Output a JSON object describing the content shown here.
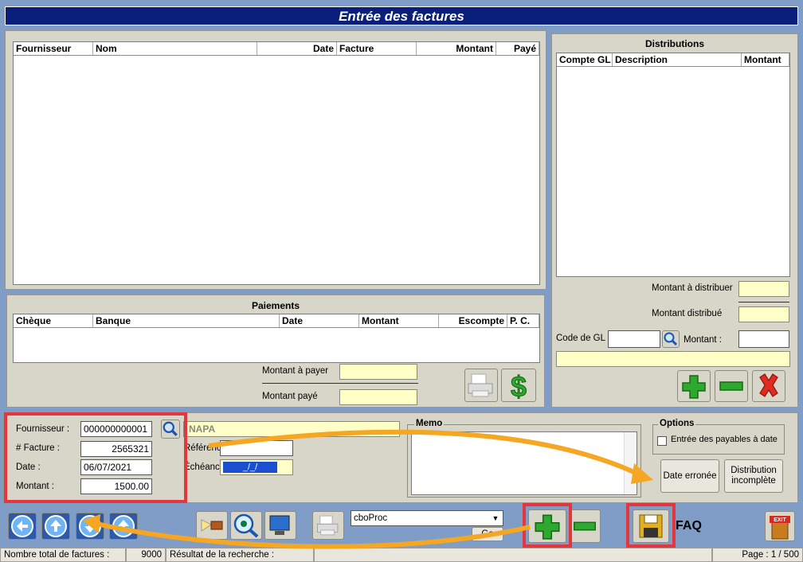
{
  "window": {
    "title": "Entrée des factures"
  },
  "invoices_table": {
    "columns": [
      "Fournisseur",
      "Nom",
      "Date",
      "Facture",
      "Montant",
      "Payé"
    ]
  },
  "distributions": {
    "caption": "Distributions",
    "columns": [
      "Compte GL",
      "Description",
      "Montant"
    ],
    "to_distribute_label": "Montant à distribuer",
    "distributed_label": "Montant distribué",
    "gl_code_label": "Code de GL :",
    "amount_label": "Montant :"
  },
  "payments": {
    "caption": "Paiements",
    "columns": [
      "Chèque",
      "Banque",
      "Date",
      "Montant",
      "Escompte",
      "P. C."
    ],
    "to_pay_label": "Montant à payer",
    "paid_label": "Montant payé"
  },
  "invoice_form": {
    "supplier_label": "Fournisseur :",
    "supplier_value": "000000000001",
    "invoice_label": "# Facture :",
    "invoice_value": "2565321",
    "date_label": "Date :",
    "date_value": "06/07/2021",
    "amount_label": "Montant :",
    "amount_value": "1500.00",
    "supplier_name": "NAPA",
    "reference_label": "Référence :",
    "due_label": "Échéance :",
    "due_value": "_/_/"
  },
  "memo": {
    "caption": "Memo"
  },
  "options": {
    "caption": "Options",
    "checkbox_label": "Entrée des payables à date",
    "wrong_date_button": "Date erronée",
    "incomplete_distribution_line1": "Distribution",
    "incomplete_distribution_line2": "incomplète"
  },
  "toolbar": {
    "proc_select_value": "cboProc",
    "go_label": "Go",
    "faq_label": "FAQ",
    "exit_label": "EXIT"
  },
  "statusbar": {
    "total_label": "Nombre total de factures :",
    "total_value": "9000",
    "search_label": "Résultat de la recherche :",
    "page_label": "Page : 1 / 500"
  },
  "colors": {
    "title_bg": "#0a1f7a",
    "highlight_red": "#e4363d",
    "arrow_orange": "#f5a623",
    "field_yellow": "#ffffc8",
    "plus_green": "#2fa82f",
    "delete_red": "#e02b20"
  }
}
